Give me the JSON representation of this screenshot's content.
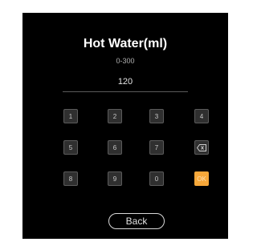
{
  "dialog": {
    "title": "Hot Water(ml)",
    "range": "0-300",
    "value": "120"
  },
  "keypad": {
    "keys": [
      "1",
      "2",
      "3",
      "4",
      "5",
      "6",
      "7",
      "8",
      "9",
      "0"
    ],
    "backspace_icon": "backspace-icon",
    "ok_label": "OK"
  },
  "back_label": "Back",
  "colors": {
    "panel": "#000000",
    "key": "#2f2f2f",
    "key_border": "#5b5b5b",
    "ok": "#f7a83a"
  }
}
